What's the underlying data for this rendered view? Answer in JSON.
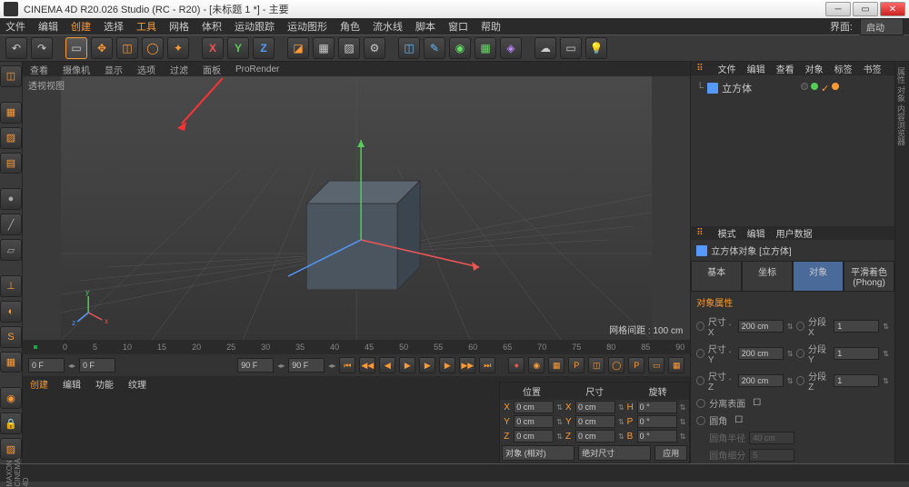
{
  "title": "CINEMA 4D R20.026 Studio (RC - R20) - [未标题 1 *] - 主要",
  "menubar": [
    "文件",
    "编辑",
    "创建",
    "选择",
    "工具",
    "网格",
    "体积",
    "运动跟踪",
    "运动图形",
    "角色",
    "流水线",
    "脚本",
    "窗口",
    "帮助"
  ],
  "menubar_hl": [
    2,
    4
  ],
  "layout_label": "界面:",
  "layout_value": "启动",
  "vp_tabs": [
    "查看",
    "摄像机",
    "显示",
    "选项",
    "过滤",
    "面板",
    "ProRender"
  ],
  "vp_label": "透视视图",
  "vp_info": "网格间距 : 100 cm",
  "timeline_ticks": [
    "0",
    "5",
    "10",
    "15",
    "20",
    "25",
    "30",
    "35",
    "40",
    "45",
    "50",
    "55",
    "60",
    "65",
    "70",
    "75",
    "80",
    "85",
    "90"
  ],
  "playback": {
    "start": "0 F",
    "cur": "0 F",
    "end": "90 F",
    "end2": "90 F"
  },
  "bottom_tabs": [
    "创建",
    "编辑",
    "功能",
    "纹理"
  ],
  "coord": {
    "headers": [
      "位置",
      "尺寸",
      "旋转"
    ],
    "rows": [
      {
        "axis": "X",
        "pos": "0 cm",
        "size": "0 cm",
        "rot": "0 °",
        "rl": "H"
      },
      {
        "axis": "Y",
        "pos": "0 cm",
        "size": "0 cm",
        "rot": "0 °",
        "rl": "P"
      },
      {
        "axis": "Z",
        "pos": "0 cm",
        "size": "0 cm",
        "rot": "0 °",
        "rl": "B"
      }
    ],
    "mode": "对象 (相对)",
    "size_mode": "绝对尺寸",
    "apply": "应用"
  },
  "obj_tabs": [
    "文件",
    "编辑",
    "查看",
    "对象",
    "标签",
    "书签"
  ],
  "obj_name": "立方体",
  "attr_tabs": [
    "模式",
    "编辑",
    "用户数据"
  ],
  "attr_title": "立方体对象 [立方体]",
  "attr_subtabs": [
    "基本",
    "坐标",
    "对象",
    "平滑着色(Phong)"
  ],
  "attr_active": 2,
  "attr_section": "对象属性",
  "attr_dims": [
    {
      "l": "尺寸 . X",
      "v": "200 cm",
      "sl": "分段 X",
      "sv": "1"
    },
    {
      "l": "尺寸 . Y",
      "v": "200 cm",
      "sl": "分段 Y",
      "sv": "1"
    },
    {
      "l": "尺寸 . Z",
      "v": "200 cm",
      "sl": "分段 Z",
      "sv": "1"
    }
  ],
  "attr_checks": [
    {
      "l": "分离表面"
    },
    {
      "l": "圆角"
    }
  ],
  "attr_disabled": [
    {
      "l": "圆角半径",
      "v": "40 cm"
    },
    {
      "l": "圆角细分",
      "v": "5"
    }
  ],
  "brand": "MAXON CINEMA 4D"
}
